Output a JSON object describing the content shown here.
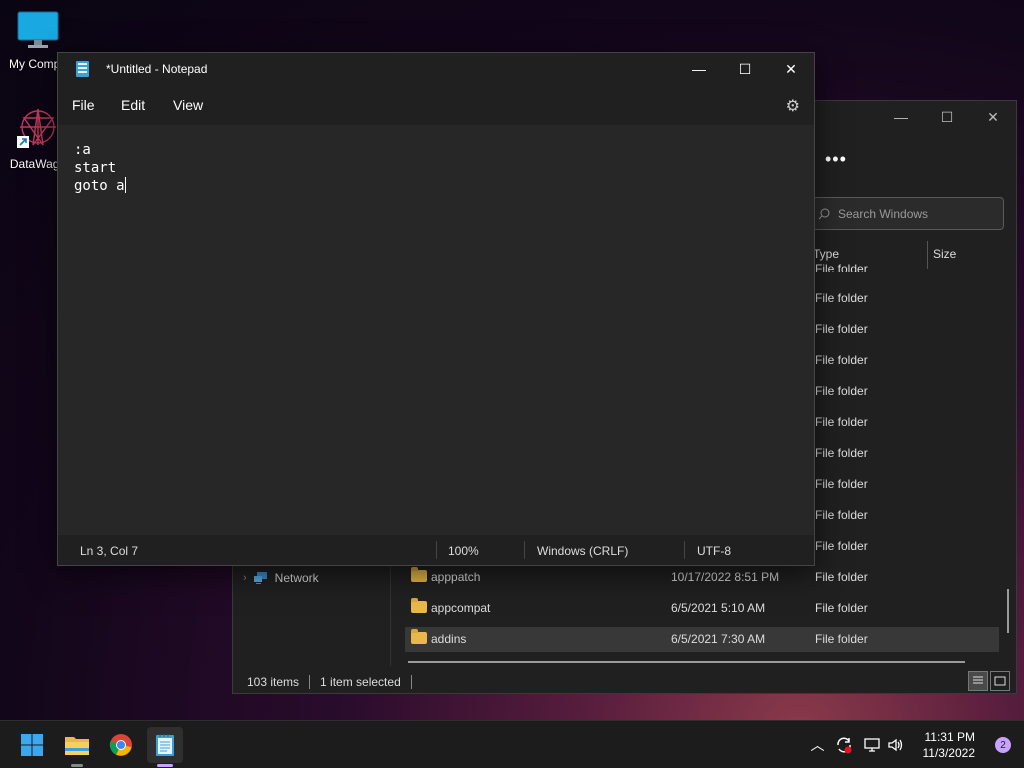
{
  "desktop": {
    "icons": [
      {
        "label": "My Compu",
        "icon": "monitor-icon"
      },
      {
        "label": "DataWago",
        "icon": "datawagon-icon"
      }
    ]
  },
  "notepad": {
    "title": "*Untitled - Notepad",
    "menu": [
      "File",
      "Edit",
      "View"
    ],
    "content": ":a\nstart\ngoto a",
    "status": {
      "position": "Ln 3, Col 7",
      "zoom": "100%",
      "line_ending": "Windows (CRLF)",
      "encoding": "UTF-8"
    }
  },
  "explorer": {
    "more_label": "•••",
    "search_placeholder": "Search Windows",
    "columns": {
      "type": "Type",
      "size": "Size"
    },
    "partial_row_type": "File folder",
    "rows_top": [
      "File folder",
      "File folder",
      "File folder",
      "File folder",
      "File folder",
      "File folder",
      "File folder",
      "File folder",
      "File folder"
    ],
    "rows": [
      {
        "name": "apppatch",
        "date": "10/17/2022 8:51 PM",
        "type": "File folder",
        "selected": false
      },
      {
        "name": "appcompat",
        "date": "6/5/2021 5:10 AM",
        "type": "File folder",
        "selected": false
      },
      {
        "name": "addins",
        "date": "6/5/2021 7:30 AM",
        "type": "File folder",
        "selected": true
      }
    ],
    "nav_network": "Network",
    "status": {
      "items": "103 items",
      "selected": "1 item selected"
    }
  },
  "taskbar": {
    "apps": [
      "windows-start-icon",
      "file-explorer-icon",
      "chrome-icon",
      "notepad-icon"
    ],
    "time": "11:31 PM",
    "date": "11/3/2022",
    "notification_count": "2"
  }
}
